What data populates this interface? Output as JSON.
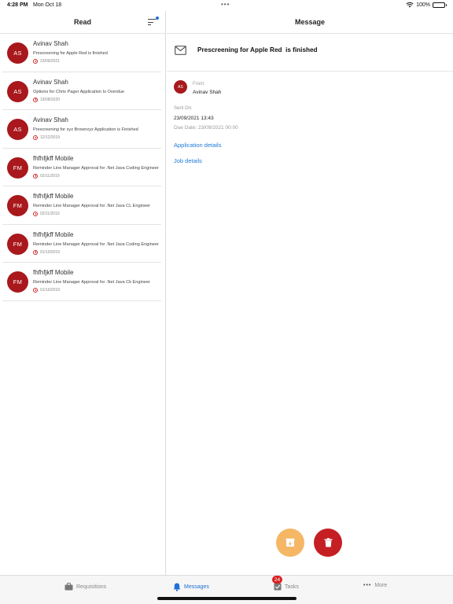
{
  "status_bar": {
    "time": "4:28 PM",
    "date": "Mon Oct 18",
    "dots": "•••",
    "battery": "100%"
  },
  "left": {
    "title": "Read",
    "messages": [
      {
        "initials": "AS",
        "sender": "Avinav Shah",
        "subject": "Prescreening for Apple Red  is finished",
        "date": "23/09/2021"
      },
      {
        "initials": "AS",
        "sender": "Avinav Shah",
        "subject": "Options for Chris Pager Application Is Overdue",
        "date": "19/08/2020"
      },
      {
        "initials": "AS",
        "sender": "Avinav Shah",
        "subject": "Prescreening for xyz Brownxyz Application is Finished",
        "date": "12/12/2019"
      },
      {
        "initials": "FM",
        "sender": "fhfhfjkff Mobile",
        "subject": "Reminder Line Manager Approval for .Net Java Coding Engineer",
        "date": "02/11/2019"
      },
      {
        "initials": "FM",
        "sender": "fhfhfjkff Mobile",
        "subject": "Reminder Line Manager Approval for .Net Java CL Engineer",
        "date": "02/11/2019"
      },
      {
        "initials": "FM",
        "sender": "fhfhfjkff Mobile",
        "subject": "Reminder Line Manager Approval for .Net Java Coding Engineer",
        "date": "01/10/2019"
      },
      {
        "initials": "FM",
        "sender": "fhfhfjkff Mobile",
        "subject": "Reminder Line Manager Approval for .Net Java Ck Engineer",
        "date": "01/10/2019"
      }
    ]
  },
  "right": {
    "title": "Message",
    "subject": "Prescreening for Apple Red  is finished",
    "sender_initials": "AS",
    "from_label": "From:",
    "from_value": "Avinav Shah",
    "sent_label": "Sent On:",
    "sent_value": "23/09/2021 13:43",
    "due_label": "Due Date:",
    "due_value": "23/09/2021 00:00",
    "link_application": "Application details",
    "link_job": "Job details"
  },
  "tabs": {
    "requisitions": "Requisitions",
    "messages": "Messages",
    "tasks": "Tasks",
    "tasks_badge": "24",
    "more": "More",
    "more_dots": "•••"
  },
  "colors": {
    "accent": "#1f6fd8",
    "avatar": "#a8181c",
    "archive_button": "#f5b766",
    "delete_button": "#c51f24"
  }
}
